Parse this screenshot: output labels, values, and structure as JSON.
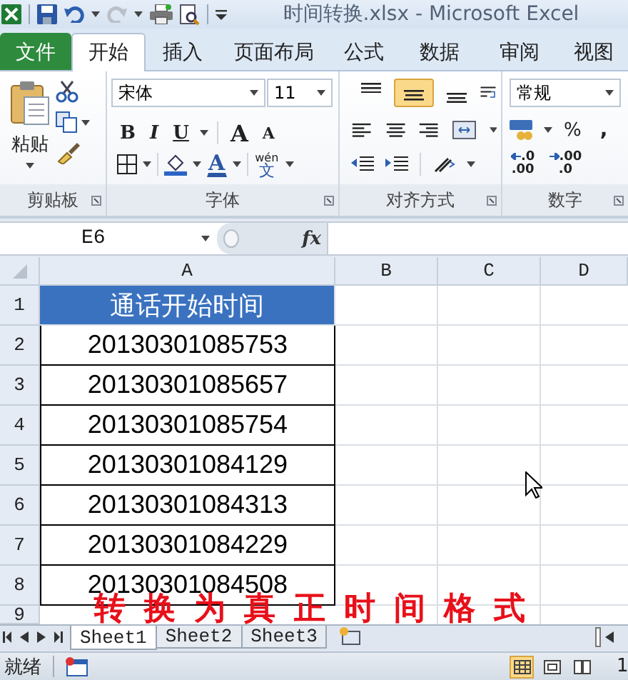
{
  "window": {
    "title": "时间转换.xlsx  -  Microsoft Excel"
  },
  "ribbon_tabs": [
    {
      "label": "文件",
      "kind": "file",
      "selected": false
    },
    {
      "label": "开始",
      "kind": "tab",
      "selected": true
    },
    {
      "label": "插入",
      "kind": "tab",
      "selected": false
    },
    {
      "label": "页面布局",
      "kind": "tab",
      "selected": false
    },
    {
      "label": "公式",
      "kind": "tab",
      "selected": false
    },
    {
      "label": "数据",
      "kind": "tab",
      "selected": false
    },
    {
      "label": "审阅",
      "kind": "tab",
      "selected": false
    },
    {
      "label": "视图",
      "kind": "tab",
      "selected": false
    }
  ],
  "ribbon": {
    "clipboard": {
      "paste": "粘贴",
      "label": "剪贴板"
    },
    "font": {
      "name": "宋体",
      "size": "11",
      "bold": "B",
      "italic": "I",
      "underline": "U",
      "grow": "A",
      "shrink": "A",
      "color_letter": "A",
      "phonetic_top": "wén",
      "phonetic_bottom": "文",
      "label": "字体"
    },
    "alignment": {
      "vertical": [
        {
          "kind": "top",
          "selected": false
        },
        {
          "kind": "middle",
          "selected": true
        },
        {
          "kind": "bottom",
          "selected": false
        }
      ],
      "label": "对齐方式"
    },
    "number": {
      "format": "常规",
      "percent": "%",
      "comma": ",",
      "decimals": [
        {
          "kind": "increase",
          "top": ".0",
          "bottom": ".00"
        },
        {
          "kind": "decrease",
          "top": ".00",
          "bottom": ".0"
        }
      ],
      "label": "数字"
    }
  },
  "formula_bar": {
    "name_box": "E6",
    "function_label": "fx"
  },
  "sheet": {
    "columns": [
      "A",
      "B",
      "C",
      "D"
    ],
    "rows": [
      {
        "header": "1",
        "kind": "title",
        "cell": "通话开始时间"
      },
      {
        "header": "2",
        "kind": "value",
        "cell": "20130301085753"
      },
      {
        "header": "3",
        "kind": "value",
        "cell": "20130301085657"
      },
      {
        "header": "4",
        "kind": "value",
        "cell": "20130301085754"
      },
      {
        "header": "5",
        "kind": "value",
        "cell": "20130301084129"
      },
      {
        "header": "6",
        "kind": "value",
        "cell": "20130301084313"
      },
      {
        "header": "7",
        "kind": "value",
        "cell": "20130301084229"
      },
      {
        "header": "8",
        "kind": "value",
        "cell": "20130301084508"
      },
      {
        "header": "9",
        "kind": "empty"
      }
    ]
  },
  "sheet_tabs": [
    {
      "label": "Sheet1",
      "selected": true
    },
    {
      "label": "Sheet2",
      "selected": false
    },
    {
      "label": "Sheet3",
      "selected": false
    }
  ],
  "status_bar": {
    "status": "就绪",
    "views": [
      {
        "kind": "normal",
        "selected": true
      },
      {
        "kind": "layout",
        "selected": false
      },
      {
        "kind": "break",
        "selected": false
      }
    ],
    "zoom": "1"
  },
  "overlay_caption": "转换为真正时间格式"
}
